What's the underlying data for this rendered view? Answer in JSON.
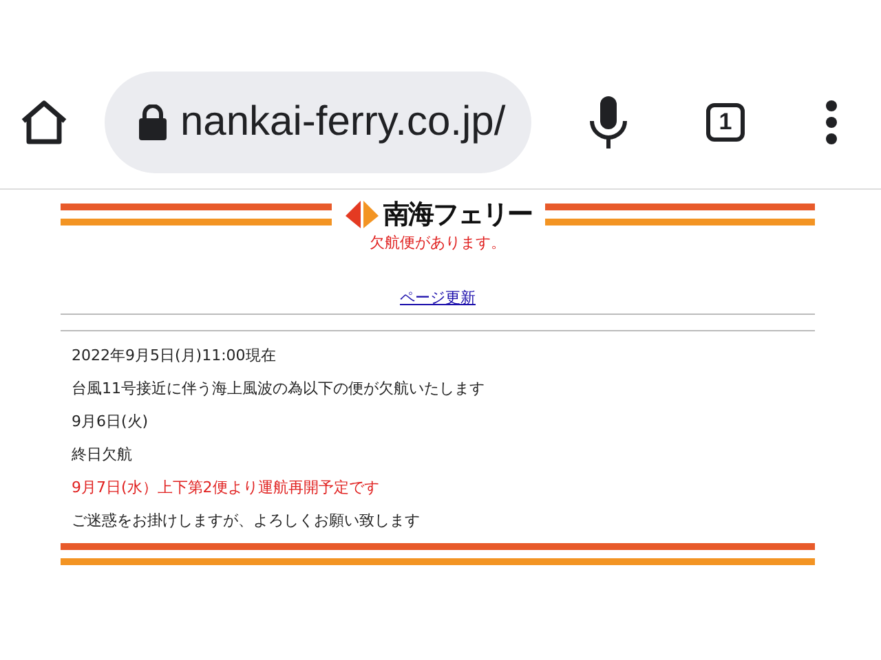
{
  "browser": {
    "url": "nankai-ferry.co.jp/",
    "tab_count": "1"
  },
  "header": {
    "logo": "南海フェリー",
    "notice": "欠航便があります。",
    "refresh_link": "ページ更新"
  },
  "lines": [
    {
      "text": "2022年9月5日(月)11:00現在",
      "kind": "plain"
    },
    {
      "text": "台風11号接近に伴う海上風波の為以下の便が欠航いたします",
      "kind": "plain"
    },
    {
      "text": "9月6日(火)",
      "kind": "plain"
    },
    {
      "text": "終日欠航",
      "kind": "plain"
    },
    {
      "text": "9月7日(水）上下第2便より運航再開予定です",
      "kind": "alert"
    },
    {
      "text": "ご迷惑をお掛けしますが、よろしくお願い致します",
      "kind": "plain"
    }
  ]
}
